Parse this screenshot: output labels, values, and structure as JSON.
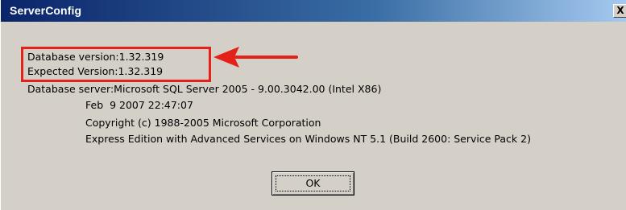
{
  "window": {
    "title": "ServerConfig",
    "close_glyph": "X",
    "colors": {
      "titlebar_start": "#0a246a",
      "titlebar_end": "#a6caf0",
      "face": "#d4d0c8",
      "highlight_box": "#e32119"
    }
  },
  "message": {
    "database_version": "Database version:1.32.319",
    "expected_version": "Expected Version:1.32.319",
    "database_server": "Database server:Microsoft SQL Server 2005 - 9.00.3042.00 (Intel X86)",
    "build_date": "Feb  9 2007 22:47:07",
    "copyright": "Copyright (c) 1988-2005 Microsoft Corporation",
    "edition": "Express Edition with Advanced Services on Windows NT 5.1 (Build 2600: Service Pack 2)"
  },
  "annotation": {
    "arrow_icon": "left-arrow-icon"
  },
  "buttons": {
    "ok_label": "OK"
  }
}
